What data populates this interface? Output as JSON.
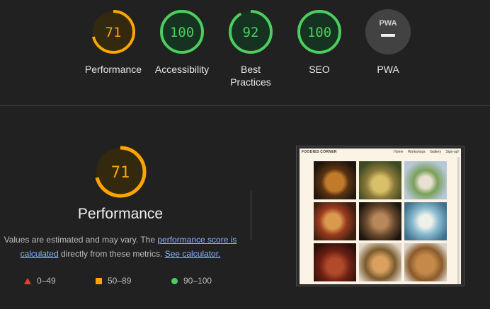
{
  "categories": [
    {
      "label": "Performance",
      "score": "71",
      "status": "average"
    },
    {
      "label": "Accessibility",
      "score": "100",
      "status": "pass"
    },
    {
      "label": "Best Practices",
      "score": "92",
      "status": "pass"
    },
    {
      "label": "SEO",
      "score": "100",
      "status": "pass"
    },
    {
      "label": "PWA",
      "score": "",
      "status": "pwa",
      "badge_text": "PWA"
    }
  ],
  "performance": {
    "score": "71",
    "title": "Performance",
    "desc_part1": "Values are estimated and may vary. The ",
    "link1": "performance score is calculated",
    "desc_part2": " directly from these metrics. ",
    "link2": "See calculator."
  },
  "legend": [
    {
      "shape": "triangle",
      "range": "0–49",
      "color": "#ef3b2c"
    },
    {
      "shape": "square",
      "range": "50–89",
      "color": "#ffa400"
    },
    {
      "shape": "circle",
      "range": "90–100",
      "color": "#4cce5f"
    }
  ],
  "screenshot": {
    "brand": "FOODIES CORNER",
    "nav": [
      "Home",
      "Workshops",
      "Gallery",
      "Sign-up!"
    ]
  },
  "colors": {
    "average": "#ffa400",
    "pass": "#4cce5f",
    "fail": "#ef3b2c",
    "background": "#212121"
  }
}
